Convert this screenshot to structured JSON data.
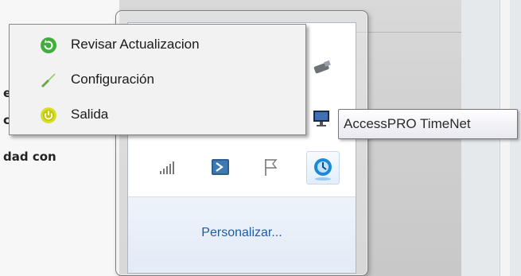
{
  "background": {
    "doc_fragments": [
      "e",
      "c",
      "dad con"
    ]
  },
  "context_menu": {
    "items": [
      {
        "label": "Revisar Actualizacion",
        "icon": "refresh-green-icon"
      },
      {
        "label": "Configuración",
        "icon": "screwdriver-icon"
      },
      {
        "label": "Salida",
        "icon": "power-icon"
      }
    ]
  },
  "tray": {
    "customize_link": "Personalizar...",
    "icons": [
      "network-signal-icon",
      "powershell-icon",
      "action-center-flag-icon",
      "accesspro-timenet-icon",
      "usb-drive-icon",
      "monitor-app-icon"
    ]
  },
  "tooltip": {
    "text": "AccessPRO TimeNet"
  },
  "colors": {
    "link": "#1e5ba8",
    "menu_bg": "#f2f2f2",
    "tooltip_border": "#767676"
  }
}
